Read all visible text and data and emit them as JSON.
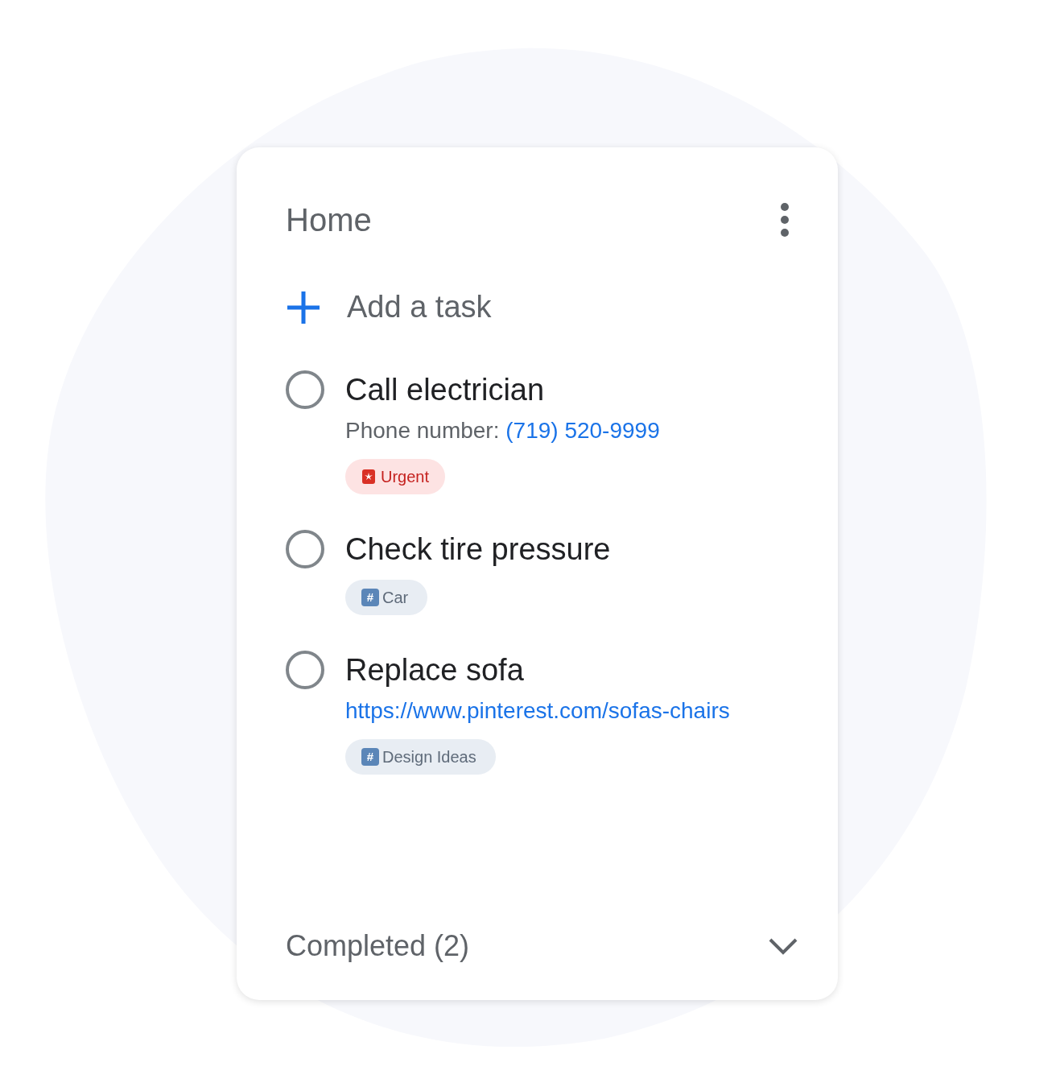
{
  "list": {
    "title": "Home"
  },
  "add_task": {
    "label": "Add a task"
  },
  "tasks": [
    {
      "title": "Call electrician",
      "checked": false,
      "note": {
        "label": "Phone number: ",
        "link": "(719) 520-9999"
      },
      "tags": [
        {
          "kind": "alert",
          "label": "Urgent"
        }
      ]
    },
    {
      "title": "Check tire pressure",
      "checked": false,
      "tags": [
        {
          "kind": "hashtag",
          "glyph": "#",
          "label": "Car"
        }
      ]
    },
    {
      "title": "Replace sofa",
      "checked": false,
      "note": {
        "link": "https://www.pinterest.com/sofas-chairs"
      },
      "tags": [
        {
          "kind": "hashtag",
          "glyph": "#",
          "label": "Design Ideas"
        }
      ]
    }
  ],
  "completed": {
    "label": "Completed (2)",
    "expanded": false
  }
}
